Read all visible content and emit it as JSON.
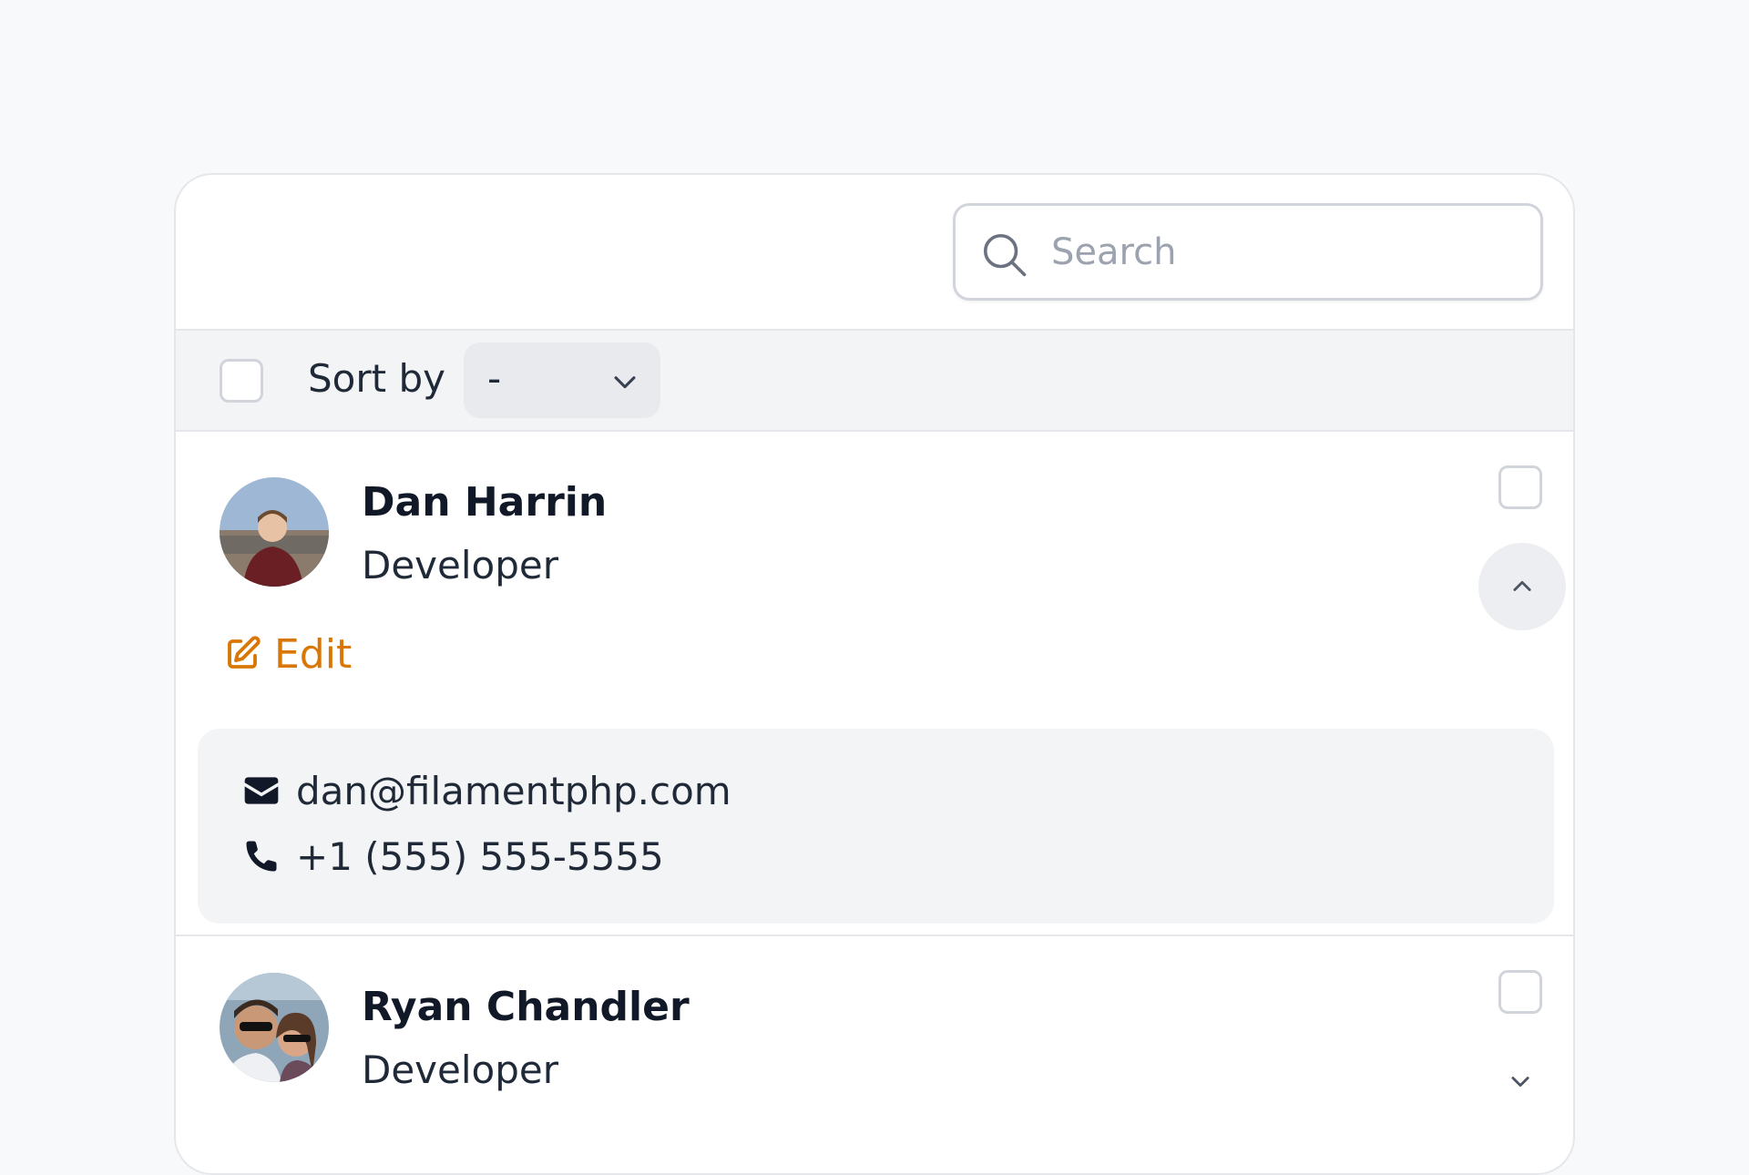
{
  "search": {
    "placeholder": "Search",
    "value": ""
  },
  "toolbar": {
    "sort_label": "Sort by",
    "sort_value": "-"
  },
  "records": [
    {
      "name": "Dan Harrin",
      "role": "Developer",
      "expanded": true,
      "edit_label": "Edit",
      "email": "dan@filamentphp.com",
      "phone": "+1 (555) 555-5555"
    },
    {
      "name": "Ryan Chandler",
      "role": "Developer",
      "expanded": false
    }
  ],
  "colors": {
    "accent": "#d97706",
    "background": "#f8f9fb",
    "toolbar": "#f3f4f6",
    "text": "#111827"
  },
  "icons": [
    "search-icon",
    "chevron-down-icon",
    "chevron-up-icon",
    "pencil-square-icon",
    "envelope-icon",
    "phone-icon"
  ]
}
